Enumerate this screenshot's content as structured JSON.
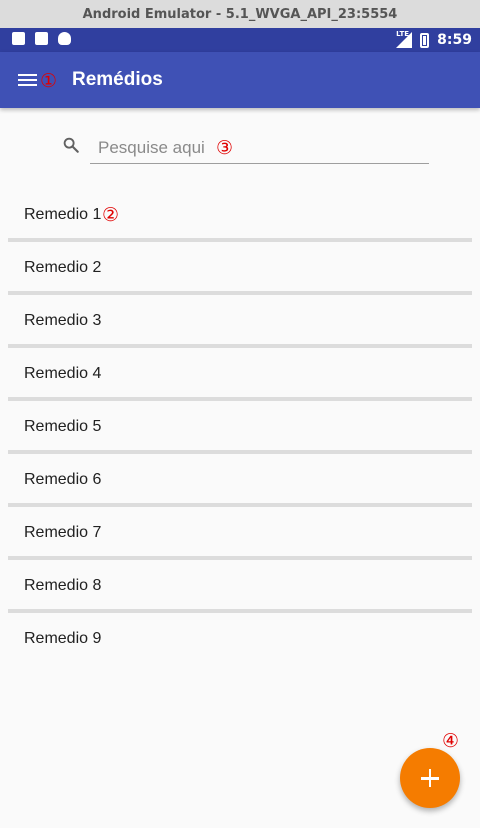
{
  "window": {
    "title": "Android Emulator - 5.1_WVGA_API_23:5554"
  },
  "status_bar": {
    "time": "8:59",
    "network": "LTE",
    "icons_left": [
      "notification-icon",
      "sd-card-icon",
      "android-icon"
    ],
    "icons_right": [
      "signal-icon",
      "battery-icon"
    ]
  },
  "app_bar": {
    "title": "Remédios",
    "menu_icon": "menu-icon",
    "color": "#3f51b5"
  },
  "search": {
    "placeholder": "Pesquise aqui",
    "value": ""
  },
  "list": {
    "items": [
      {
        "label": "Remedio 1"
      },
      {
        "label": "Remedio 2"
      },
      {
        "label": "Remedio 3"
      },
      {
        "label": "Remedio 4"
      },
      {
        "label": "Remedio 5"
      },
      {
        "label": "Remedio 6"
      },
      {
        "label": "Remedio 7"
      },
      {
        "label": "Remedio 8"
      },
      {
        "label": "Remedio 9"
      }
    ]
  },
  "fab": {
    "icon": "plus-icon",
    "color": "#f57c00"
  },
  "annotations": {
    "m1": "①",
    "m2": "②",
    "m3": "③",
    "m4": "④"
  }
}
